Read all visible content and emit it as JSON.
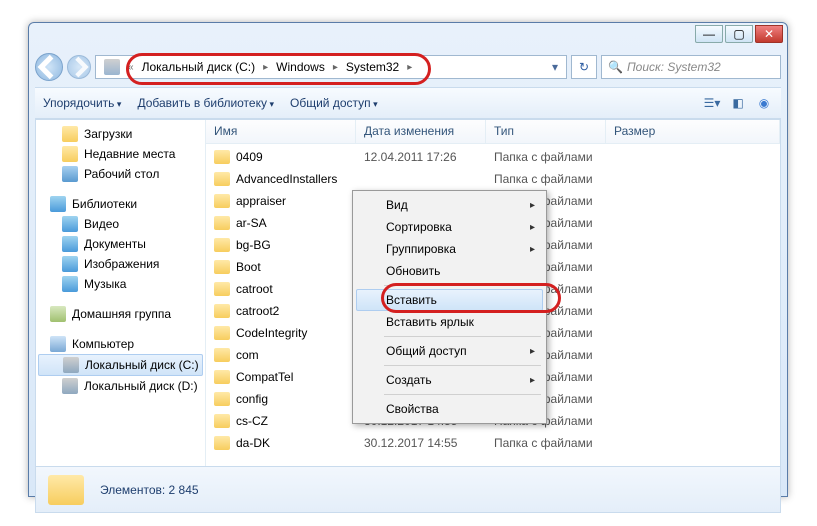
{
  "titlebar": {
    "min": "—",
    "max": "▢",
    "close": "✕"
  },
  "address": {
    "segments": [
      "Локальный диск (C:)",
      "Windows",
      "System32"
    ]
  },
  "search": {
    "placeholder": "Поиск: System32"
  },
  "toolbar": {
    "organize": "Упорядочить",
    "addlib": "Добавить в библиотеку",
    "share": "Общий доступ"
  },
  "tree": {
    "downloads": "Загрузки",
    "recent": "Недавние места",
    "desktop": "Рабочий стол",
    "libraries": "Библиотеки",
    "video": "Видео",
    "documents": "Документы",
    "pictures": "Изображения",
    "music": "Музыка",
    "homegroup": "Домашняя группа",
    "computer": "Компьютер",
    "cdrive": "Локальный диск (C:)",
    "ddrive": "Локальный диск (D:)"
  },
  "columns": {
    "name": "Имя",
    "date": "Дата изменения",
    "type": "Тип",
    "size": "Размер"
  },
  "rows": [
    {
      "name": "0409",
      "date": "12.04.2011 17:26",
      "type": "Папка с файлами"
    },
    {
      "name": "AdvancedInstallers",
      "date": "",
      "type": "Папка с файлами"
    },
    {
      "name": "appraiser",
      "date": "",
      "type": "Папка с файлами"
    },
    {
      "name": "ar-SA",
      "date": "",
      "type": "Папка с файлами"
    },
    {
      "name": "bg-BG",
      "date": "",
      "type": "Папка с файлами"
    },
    {
      "name": "Boot",
      "date": "",
      "type": "Папка с файлами"
    },
    {
      "name": "catroot",
      "date": "",
      "type": "Папка с файлами"
    },
    {
      "name": "catroot2",
      "date": "",
      "type": "Папка с файлами"
    },
    {
      "name": "CodeIntegrity",
      "date": "",
      "type": "Папка с файлами"
    },
    {
      "name": "com",
      "date": "",
      "type": "Папка с файлами"
    },
    {
      "name": "CompatTel",
      "date": "",
      "type": "Папка с файлами"
    },
    {
      "name": "config",
      "date": "",
      "type": "Папка с файлами"
    },
    {
      "name": "cs-CZ",
      "date": "30.12.2017 14:55",
      "type": "Папка с файлами"
    },
    {
      "name": "da-DK",
      "date": "30.12.2017 14:55",
      "type": "Папка с файлами"
    }
  ],
  "context": {
    "view": "Вид",
    "sort": "Сортировка",
    "group": "Группировка",
    "refresh": "Обновить",
    "paste": "Вставить",
    "paste_shortcut": "Вставить ярлык",
    "share": "Общий доступ",
    "create": "Создать",
    "properties": "Свойства"
  },
  "status": {
    "items": "Элементов: 2 845"
  }
}
